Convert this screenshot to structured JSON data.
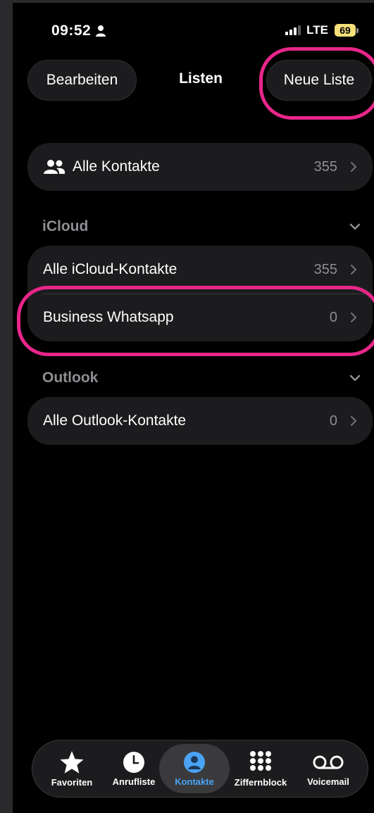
{
  "status_bar": {
    "time": "09:52",
    "network": "LTE",
    "battery": "69",
    "battery_color": "#f5e07a"
  },
  "nav": {
    "edit_label": "Bearbeiten",
    "title": "Listen",
    "new_list_label": "Neue Liste"
  },
  "all_contacts": {
    "label": "Alle Kontakte",
    "count": "355",
    "icon": "people-icon"
  },
  "sections": [
    {
      "title": "iCloud",
      "rows": [
        {
          "label": "Alle iCloud-Kontakte",
          "count": "355"
        },
        {
          "label": "Business Whatsapp",
          "count": "0"
        }
      ]
    },
    {
      "title": "Outlook",
      "rows": [
        {
          "label": "Alle Outlook-Kontakte",
          "count": "0"
        }
      ]
    }
  ],
  "tabs": [
    {
      "label": "Favoriten",
      "icon": "star-icon"
    },
    {
      "label": "Anrufliste",
      "icon": "clock-icon"
    },
    {
      "label": "Kontakte",
      "icon": "person-circle-icon",
      "active": true
    },
    {
      "label": "Ziffernblock",
      "icon": "keypad-icon"
    },
    {
      "label": "Voicemail",
      "icon": "voicemail-icon"
    }
  ],
  "colors": {
    "highlight": "#e8268a",
    "accent": "#4aa3f5",
    "background": "#000000",
    "surface": "#1c1c1e"
  }
}
